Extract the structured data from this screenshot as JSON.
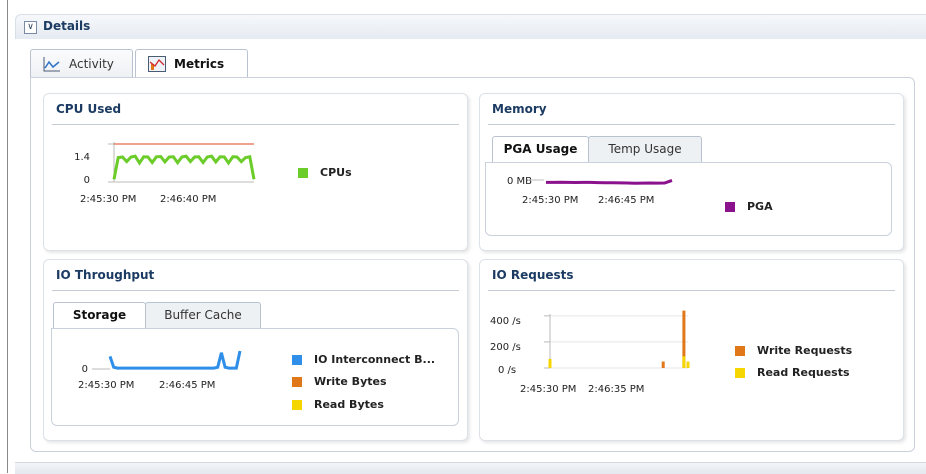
{
  "details": {
    "title": "Details"
  },
  "tabs": [
    {
      "label": "Activity",
      "icon": "activity-chart-icon",
      "active": false
    },
    {
      "label": "Metrics",
      "icon": "metrics-chart-icon",
      "active": true
    }
  ],
  "colors": {
    "cpu": "#6bcc2a",
    "cpu_limit": "#e0451e",
    "pga": "#8b128d",
    "io_interconnect": "#2f8fe8",
    "write": "#e0781a",
    "read": "#f5d600",
    "title_blue": "#1c3b63"
  },
  "panels": {
    "cpu_used": {
      "title": "CPU Used",
      "y_ticks": [
        "1.4",
        "0"
      ],
      "x_ticks": [
        "2:45:30 PM",
        "2:46:40 PM"
      ],
      "legend": [
        {
          "label": "CPUs",
          "color": "#6bcc2a"
        }
      ]
    },
    "memory": {
      "title": "Memory",
      "subtabs": [
        {
          "label": "PGA Usage",
          "active": true
        },
        {
          "label": "Temp Usage",
          "active": false
        }
      ],
      "y_ticks": [
        "0 MB"
      ],
      "x_ticks": [
        "2:45:30 PM",
        "2:46:45 PM"
      ],
      "legend": [
        {
          "label": "PGA",
          "color": "#8b128d"
        }
      ]
    },
    "io_throughput": {
      "title": "IO Throughput",
      "subtabs": [
        {
          "label": "Storage",
          "active": true
        },
        {
          "label": "Buffer Cache",
          "active": false
        }
      ],
      "y_ticks": [
        "0"
      ],
      "x_ticks": [
        "2:45:30 PM",
        "2:46:45 PM"
      ],
      "legend": [
        {
          "label": "IO Interconnect B...",
          "color": "#2f8fe8"
        },
        {
          "label": "Write Bytes",
          "color": "#e0781a"
        },
        {
          "label": "Read Bytes",
          "color": "#f5d600"
        }
      ]
    },
    "io_requests": {
      "title": "IO Requests",
      "y_ticks": [
        "400 /s",
        "200 /s",
        "0 /s"
      ],
      "x_ticks": [
        "2:45:30 PM",
        "2:46:35 PM"
      ],
      "legend": [
        {
          "label": "Write Requests",
          "color": "#e0781a"
        },
        {
          "label": "Read Requests",
          "color": "#f5d600"
        }
      ]
    }
  },
  "chart_data": [
    {
      "type": "line",
      "title": "CPU Used",
      "ylim": [
        0,
        1.4
      ],
      "series": [
        {
          "name": "CPUs",
          "values": [
            0.1,
            0.9,
            0.92,
            0.75,
            0.92,
            0.95,
            0.7,
            0.93,
            0.92,
            0.72,
            0.93,
            0.94,
            0.74,
            0.92,
            0.93,
            0.71,
            0.92,
            0.95,
            0.75,
            0.92,
            0.93,
            0.72,
            0.92,
            0.95,
            0.74,
            0.93,
            0.92,
            0.7,
            0.93,
            0.92,
            0.75,
            0.9,
            0.93,
            0.1
          ]
        }
      ],
      "limit": 1.4
    },
    {
      "type": "line",
      "title": "Memory",
      "series": [
        {
          "name": "PGA",
          "values": [
            0.2,
            0.2,
            0.22,
            0.2,
            0.19,
            0.2,
            0.2,
            0.18,
            0.15,
            0.15,
            0.14,
            0.13,
            0.1,
            0.11,
            0.12,
            0.11,
            0.12,
            0.45
          ]
        }
      ]
    },
    {
      "type": "line",
      "title": "IO Throughput",
      "series": [
        {
          "name": "IO Interconnect B...",
          "values": [
            0.7,
            0.1,
            0.05,
            0.05,
            0.05,
            0.05,
            0.05,
            0.05,
            0.05,
            0.05,
            0.05,
            0.05,
            0.05,
            0.05,
            0.05,
            0.05,
            0.05,
            0.05,
            0.05,
            0.05,
            0.05,
            0.05,
            0.05,
            0.05,
            0.05,
            0.05,
            0.05,
            0.05,
            0.05,
            0.1,
            0.9,
            0.1,
            0.05,
            0.05,
            0.05,
            1.0
          ]
        }
      ]
    },
    {
      "type": "bar",
      "title": "IO Requests",
      "ylim": [
        0,
        460
      ],
      "series": [
        {
          "name": "Write Requests",
          "points": [
            [
              0.82,
              50
            ],
            [
              0.97,
              440
            ]
          ]
        },
        {
          "name": "Read Requests",
          "points": [
            [
              0.0,
              70
            ],
            [
              0.97,
              90
            ],
            [
              1.0,
              50
            ]
          ]
        }
      ]
    }
  ]
}
